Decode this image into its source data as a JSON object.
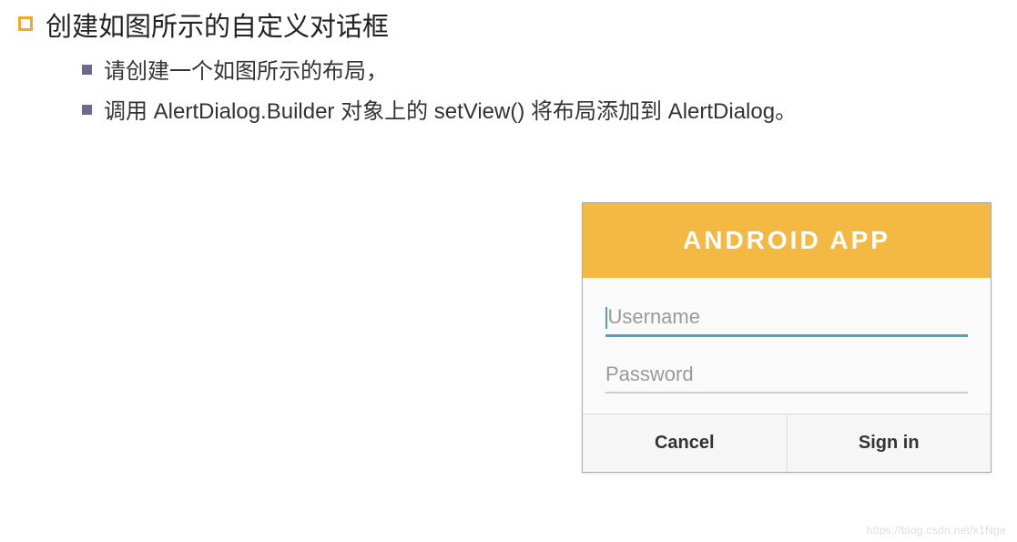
{
  "main": {
    "title": "创建如图所示的自定义对话框"
  },
  "sub_items": [
    {
      "text": "请创建一个如图所示的布局，"
    },
    {
      "text": "调用 AlertDialog.Builder 对象上的 setView() 将布局添加到 AlertDialog。"
    }
  ],
  "dialog": {
    "header": "ANDROID APP",
    "username_placeholder": "Username",
    "password_placeholder": "Password",
    "cancel_label": "Cancel",
    "signin_label": "Sign in"
  },
  "watermark": "https://blog.csdn.net/x1Nge"
}
